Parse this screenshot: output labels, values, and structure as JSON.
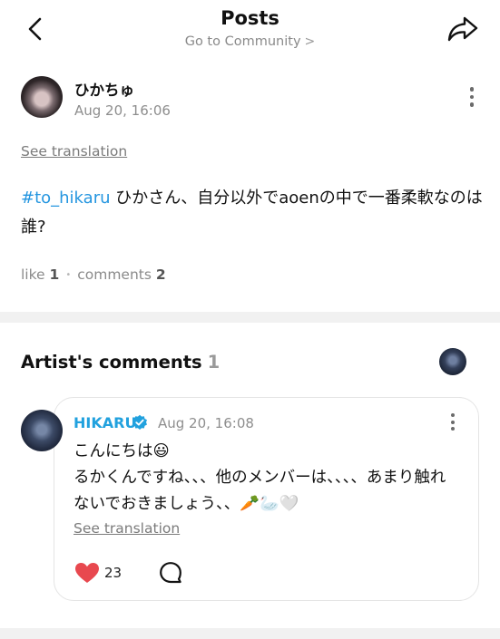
{
  "header": {
    "title": "Posts",
    "community_link": "Go to Community",
    "community_chevron": ">"
  },
  "post": {
    "author": "ひかちゅ",
    "timestamp": "Aug 20, 16:06",
    "see_translation": "See translation",
    "hashtag": "#to_hikaru",
    "body": " ひかさん、自分以外でaoenの中で一番柔軟なのは誰?",
    "like_label": "like",
    "like_count": "1",
    "comments_label": "comments",
    "comments_count": "2",
    "separator": "•"
  },
  "artist_comments": {
    "title": "Artist's comments",
    "count": "1",
    "comment": {
      "author": "HIKARU",
      "timestamp": "Aug 20, 16:08",
      "body": "こんにちは😃\nるかくんですね、、、他のメンバーは、、、、あまり触れないでおきましょう、、🥕🦢🤍",
      "see_translation": "See translation",
      "like_count": "23"
    }
  },
  "colors": {
    "hashtag": "#2596e0",
    "artist_name": "#21a1de",
    "verified_badge": "#21a1de",
    "heart": "#e8484f",
    "muted_text": "#8a8a8a",
    "divider": "#f1f1f1"
  },
  "icons": {
    "back": "chevron-left-icon",
    "share": "share-arrow-icon",
    "more": "more-vertical-icon",
    "verified": "verified-badge-icon",
    "like": "heart-icon",
    "reply": "speech-bubble-icon"
  }
}
